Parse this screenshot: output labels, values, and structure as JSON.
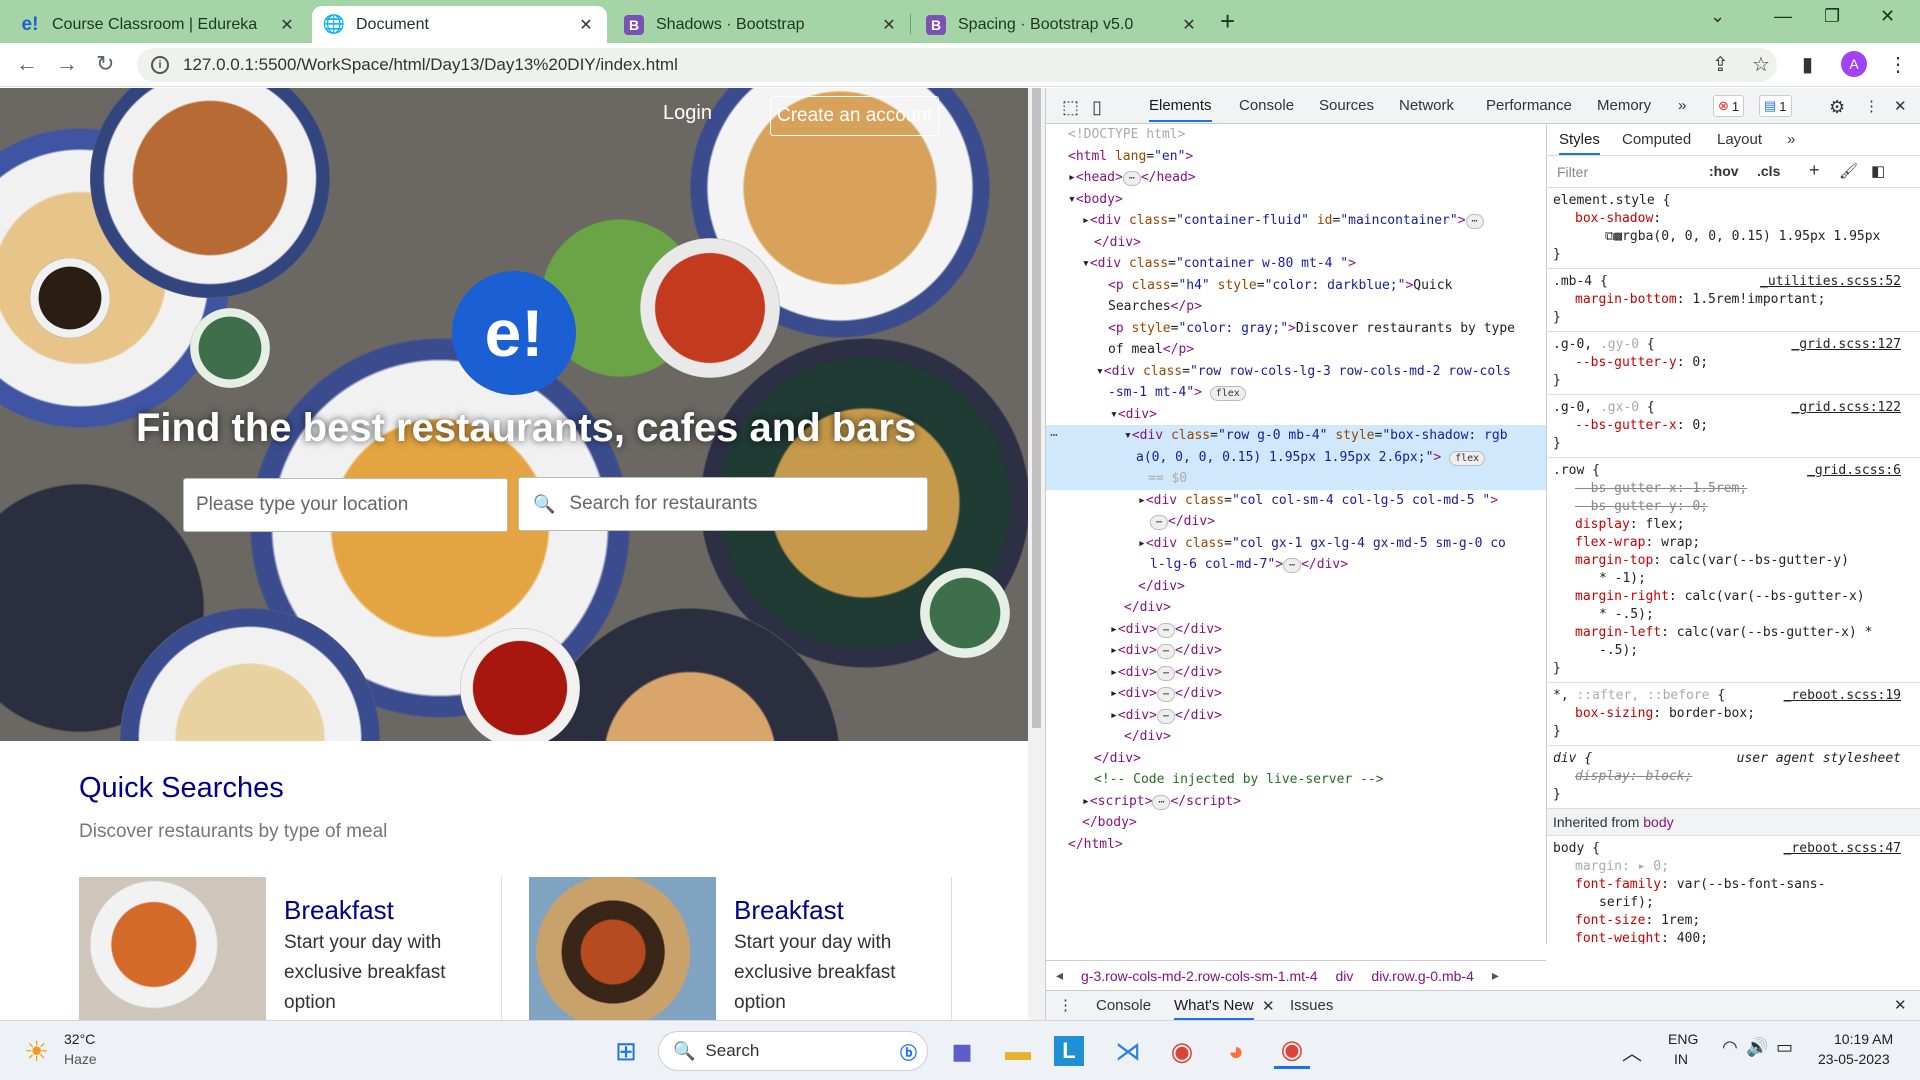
{
  "tabs": [
    {
      "label": "Course Classroom | Edureka",
      "fav": "e!",
      "fav_color": "#1a5fd4"
    },
    {
      "label": "Document",
      "fav": "globe-icon",
      "fav_color": "#5f6368"
    },
    {
      "label": "Shadows · Bootstrap",
      "fav": "B",
      "fav_color": "#7952b3"
    },
    {
      "label": "Spacing · Bootstrap v5.0",
      "fav": "B",
      "fav_color": "#7952b3"
    }
  ],
  "address": {
    "url": "127.0.0.1:5500/WorkSpace/html/Day13/Day13%20DIY/index.html",
    "avatar": "A"
  },
  "page": {
    "login": "Login",
    "create": "Create an account",
    "logo": "e!",
    "headline": "Find the best restaurants, cafes and bars",
    "location_placeholder": "Please type your location",
    "search_placeholder": "Search for restaurants",
    "qs_title": "Quick Searches",
    "qs_desc": "Discover restaurants by type of meal",
    "cards": [
      {
        "title": "Breakfast",
        "desc": "Start your day with exclusive breakfast option"
      },
      {
        "title": "Breakfast",
        "desc": "Start your day with exclusive breakfast option"
      }
    ]
  },
  "devtools": {
    "tabs": [
      "Elements",
      "Console",
      "Sources",
      "Network",
      "Performance",
      "Memory"
    ],
    "errors": "1",
    "messages": "1",
    "style_tabs": [
      "Styles",
      "Computed",
      "Layout"
    ],
    "filter": "Filter",
    "hov": ":hov",
    "cls": ".cls",
    "inherited": "Inherited from",
    "inherited_el": "body",
    "breadcrumb": [
      "g-3.row-cols-md-2.row-cols-sm-1.mt-4",
      "div",
      "div.row.g-0.mb-4"
    ],
    "drawer_tabs": [
      "Console",
      "What's New",
      "Issues"
    ]
  },
  "taskbar": {
    "temp": "32°C",
    "weather": "Haze",
    "search": "Search",
    "lang1": "ENG",
    "lang2": "IN",
    "time": "10:19 AM",
    "date": "23-05-2023"
  }
}
